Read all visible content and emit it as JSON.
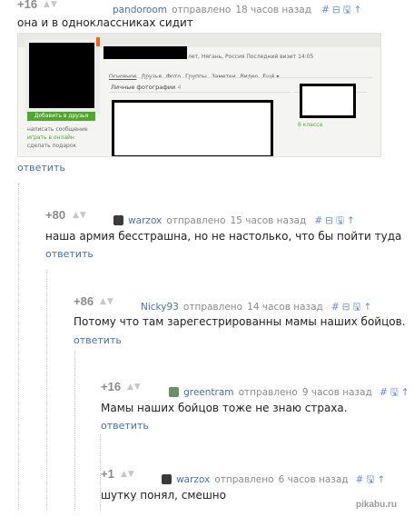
{
  "comments": [
    {
      "score": "+16",
      "user": "pandoroom",
      "sent": "отправлено",
      "time": "18 часов назад",
      "text": "она и в одноклассниках сидит",
      "reply": "ответить"
    },
    {
      "score": "+80",
      "user": "warzox",
      "sent": "отправлено",
      "time": "15 часов назад",
      "text": "наша армия бесстрашна, но не настолько, что бы пойти туда",
      "reply": "ответить"
    },
    {
      "score": "+86",
      "user": "Nicky93",
      "sent": "отправлено",
      "time": "14 часов назад",
      "text": "Потому что там зарегестрированны мамы наших бойцов.",
      "reply": "ответить"
    },
    {
      "score": "+16",
      "user": "greentram",
      "sent": "отправлено",
      "time": "9 часов назад",
      "text": "Мамы наших бойцов тоже не знаю страха.",
      "reply": "ответить"
    },
    {
      "score": "+1",
      "user": "warzox",
      "sent": "отправлено",
      "time": "6 часов назад",
      "text": "шутку понял, смешно",
      "reply": ""
    }
  ],
  "icons": {
    "hash": "#",
    "minus": "⊟",
    "save": "🖫",
    "up": "↑",
    "arrow_up": "▲",
    "arrow_down": "▼"
  },
  "ok_screenshot": {
    "location": "лет, Нягань, Россия  Последний визит 14:05",
    "tabs": [
      "Основное",
      "Друзья",
      "Фото",
      "Группы",
      "Заметки",
      "Видео",
      "Ещё ▾"
    ],
    "add_friend": "Добавить в друзья",
    "side_links": [
      "написать сообщение",
      "играть в онлайн",
      "сделать подарок"
    ],
    "photos_label": "Личные фотографии",
    "photos_count": "4",
    "friend_count": "6 класса"
  },
  "watermark": "pikabu.ru"
}
